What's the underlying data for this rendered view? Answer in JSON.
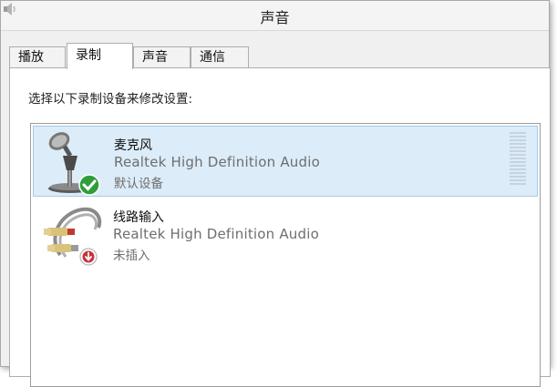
{
  "window": {
    "title": "声音"
  },
  "tabs": [
    {
      "label": "播放",
      "active": false
    },
    {
      "label": "录制",
      "active": true
    },
    {
      "label": "声音",
      "active": false
    },
    {
      "label": "通信",
      "active": false
    }
  ],
  "instruction": "选择以下录制设备来修改设置:",
  "devices": [
    {
      "name": "麦克风",
      "driver": "Realtek High Definition Audio",
      "status": "默认设备",
      "selected": true,
      "icon": "microphone-icon",
      "badge": "default-check-icon"
    },
    {
      "name": "线路输入",
      "driver": "Realtek High Definition Audio",
      "status": "未插入",
      "selected": false,
      "icon": "line-in-cable-icon",
      "badge": "unplugged-arrow-icon"
    }
  ],
  "colors": {
    "selection": "#dcecf8",
    "check": "#2f9e3a",
    "unplugged": "#c8313a"
  }
}
